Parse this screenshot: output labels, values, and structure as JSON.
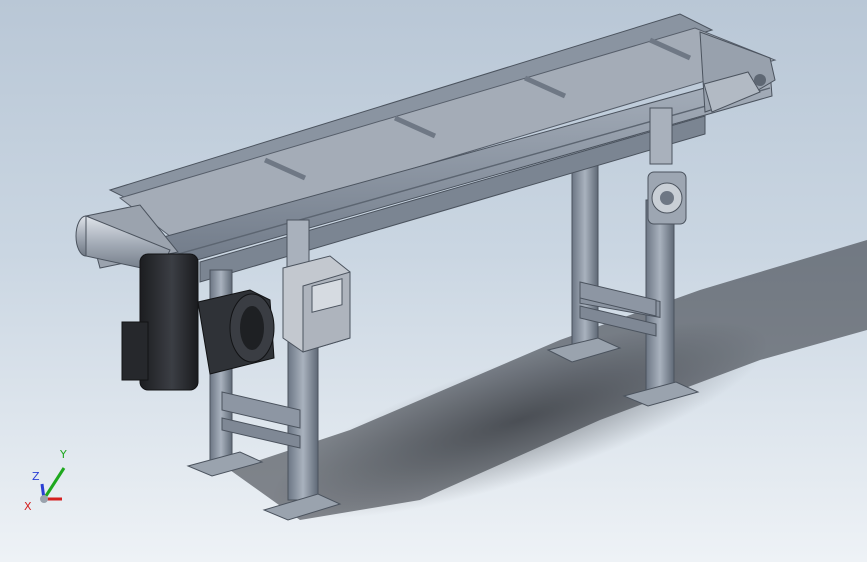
{
  "viewport": {
    "background_top": "#b9c7d6",
    "background_bottom": "#eef2f6"
  },
  "model": {
    "frame_color": "#8e98a6",
    "belt_color": "#a4acb7",
    "motor_color": "#2b2d31",
    "panel_color": "#c3c8cf"
  },
  "triad": {
    "x_label": "X",
    "y_label": "Y",
    "z_label": "Z",
    "x_color": "#d42020",
    "y_color": "#1ea81e",
    "z_color": "#2a3fd4"
  }
}
